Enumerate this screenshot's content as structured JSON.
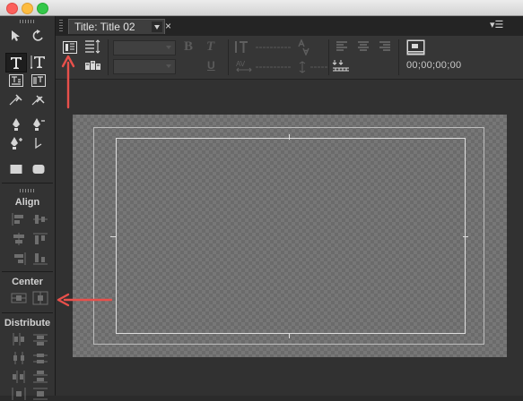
{
  "window": {
    "controls": [
      "close",
      "minimize",
      "zoom"
    ]
  },
  "tab": {
    "label": "Title: Title 02",
    "close": "×",
    "panel_menu": "▾☰"
  },
  "tools": {
    "items": [
      "selection",
      "rotation",
      "type",
      "vertical-type",
      "area-type",
      "vertical-area-type",
      "path-type",
      "vertical-path-type",
      "pen",
      "delete-anchor",
      "add-anchor",
      "convert-anchor",
      "rectangle",
      "rounded-rectangle"
    ],
    "selected": "type"
  },
  "sections": {
    "align": "Align",
    "center": "Center",
    "distribute": "Distribute"
  },
  "options": {
    "bold": "B",
    "italic": "T",
    "underline": "U",
    "timecode": "00;00;00;00"
  },
  "colors": {
    "annotation_arrow": "#e8504b",
    "panel": "#333333",
    "canvas_checker_a": "#6b6b6b",
    "canvas_checker_b": "#777777"
  }
}
